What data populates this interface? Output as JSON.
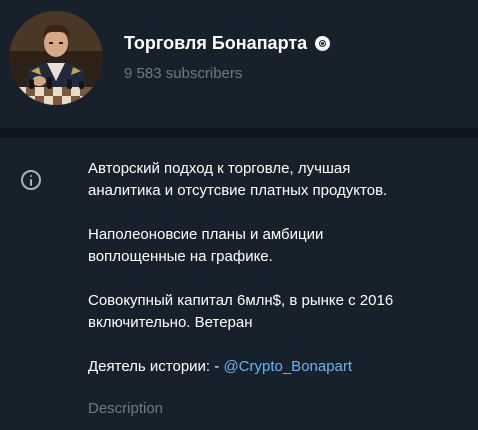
{
  "channel": {
    "title": "Торговля Бонапарта",
    "subscribers": "9 583 subscribers",
    "avatar_icon": "chess-player-portrait",
    "badge_icon": "coin-badge-icon"
  },
  "info": {
    "icon": "info-icon",
    "paragraphs": [
      "Авторский подход к торговле, лучшая\nаналитика и отсутсвие платных продуктов.",
      "Наполеоновсие планы и амбиции\nвоплощенные на графике.",
      "Совокупный капитал 6млн$, в рынке с 2016\nвключительно. Ветеран"
    ],
    "last_prefix": "Деятель истории: - ",
    "mention": "@Crypto_Bonapart",
    "label": "Description"
  },
  "colors": {
    "background": "#17212b",
    "divider": "#0e1621",
    "secondary_text": "#6c7883",
    "link": "#6ab3f3"
  }
}
